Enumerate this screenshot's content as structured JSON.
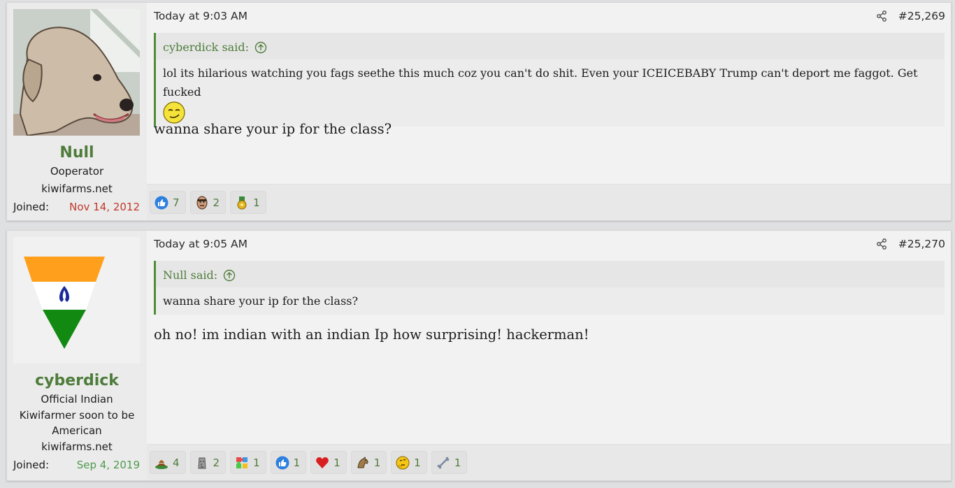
{
  "posts": [
    {
      "username": "Null",
      "user_title": "Ooperator",
      "site": "kiwifarms.net",
      "joined_label": "Joined:",
      "joined_date": "Nov 14, 2012",
      "timestamp": "Today at 9:03 AM",
      "post_number": "#25,269",
      "quote": {
        "author": "cyberdick said:",
        "text": "lol its hilarious watching you fags seethe this much coz you can't do shit. Even your ICEICEBABY Trump can't deport me faggot. Get fucked"
      },
      "message": "wanna share your ip for the class?",
      "reactions": [
        {
          "icon": "thumbs-up-icon",
          "count": "7"
        },
        {
          "icon": "face-icon",
          "count": "2"
        },
        {
          "icon": "medal-icon",
          "count": "1"
        }
      ]
    },
    {
      "username": "cyberdick",
      "user_title": "Official Indian Kiwifarmer soon to be American",
      "site": "kiwifarms.net",
      "joined_label": "Joined:",
      "joined_date": "Sep 4, 2019",
      "timestamp": "Today at 9:05 AM",
      "post_number": "#25,270",
      "quote": {
        "author": "Null said:",
        "text": "wanna share your ip for the class?"
      },
      "message": "oh no! im indian with an indian Ip how surprising! hackerman!",
      "reactions": [
        {
          "icon": "dung-icon",
          "count": "4"
        },
        {
          "icon": "moai-icon",
          "count": "2"
        },
        {
          "icon": "puzzle-icon",
          "count": "1"
        },
        {
          "icon": "thumbs-up-icon",
          "count": "1"
        },
        {
          "icon": "heart-icon",
          "count": "1"
        },
        {
          "icon": "horse-icon",
          "count": "1"
        },
        {
          "icon": "thinking-icon",
          "count": "1"
        },
        {
          "icon": "bone-icon",
          "count": "1"
        }
      ]
    }
  ]
}
